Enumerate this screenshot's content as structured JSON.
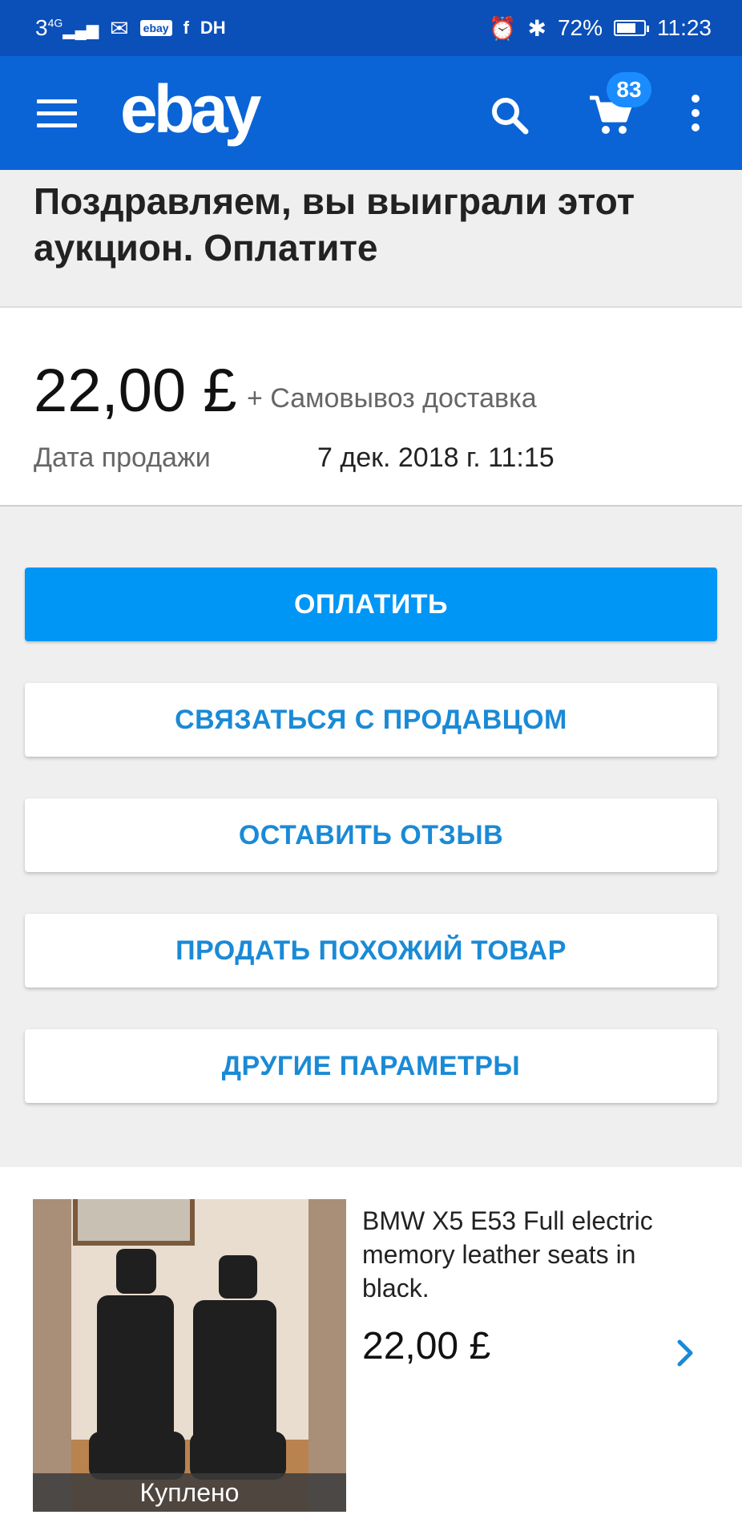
{
  "status_bar": {
    "network": "3",
    "network_type": "4G",
    "ebay_badge": "ebay",
    "notification_extra": "DH",
    "battery": "72%",
    "battery_level": 0.72,
    "time": "11:23"
  },
  "app_bar": {
    "logo": "ebay",
    "cart_count": "83",
    "colors": {
      "background": "#0a64d6",
      "status_bar": "#0b4fb8"
    }
  },
  "headline": "Поздравляем, вы выиграли этот аукцион. Оплатите",
  "price_card": {
    "price": "22,00 £",
    "shipping": "+ Самовывоз доставка",
    "date_label": "Дата продажи",
    "date_value": "7 дек. 2018 г. 11:15"
  },
  "actions": {
    "pay": "ОПЛАТИТЬ",
    "contact_seller": "СВЯЗАТЬСЯ С ПРОДАВЦОМ",
    "leave_feedback": "ОСТАВИТЬ ОТЗЫВ",
    "sell_similar": "ПРОДАТЬ ПОХОЖИЙ ТОВАР",
    "other_options": "ДРУГИЕ ПАРАМЕТРЫ",
    "colors": {
      "primary": "#0096f5",
      "secondary_text": "#1a8ad6"
    }
  },
  "item": {
    "image_caption": "Куплено",
    "title": "BMW X5 E53 Full electric memory leather seats in black.",
    "price": "22,00 £"
  }
}
